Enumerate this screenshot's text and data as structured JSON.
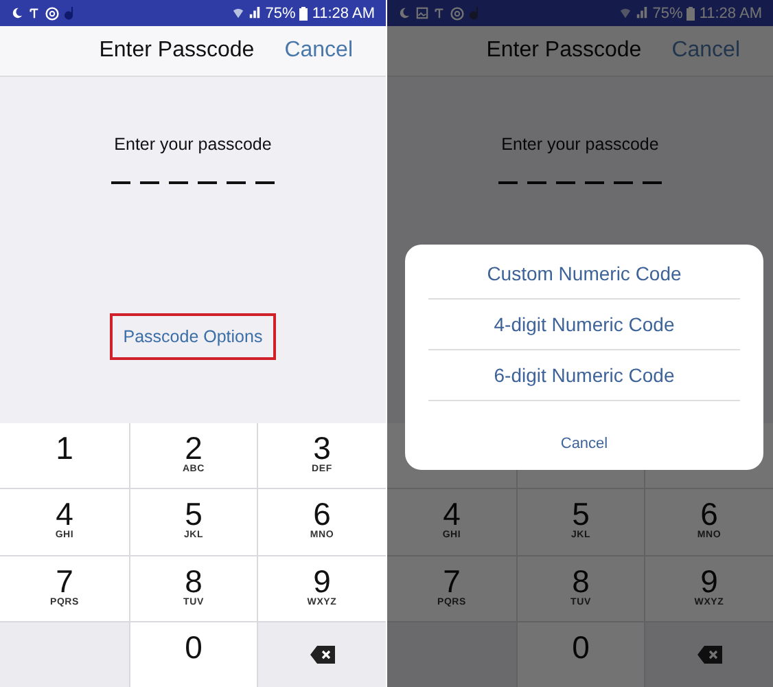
{
  "screens": [
    {
      "status_bar": {
        "battery": "75%",
        "time": "11:28 AM",
        "extra_icon": false
      },
      "title": "Enter Passcode",
      "cancel": "Cancel",
      "prompt": "Enter your passcode",
      "slots": [
        {
          "kind": "empty"
        },
        {
          "kind": "empty"
        },
        {
          "kind": "empty"
        },
        {
          "kind": "empty"
        },
        {
          "kind": "empty"
        },
        {
          "kind": "empty"
        }
      ],
      "options_link": {
        "label": "Passcode Options",
        "highlighted": true
      },
      "dimmed": false,
      "keypad": [
        {
          "kind": "digit",
          "digit": "1"
        },
        {
          "kind": "digit",
          "digit": "2",
          "letters": "ABC"
        },
        {
          "kind": "digit",
          "digit": "3",
          "letters": "DEF"
        },
        {
          "kind": "digit",
          "digit": "4",
          "letters": "GHI"
        },
        {
          "kind": "digit",
          "digit": "5",
          "letters": "JKL"
        },
        {
          "kind": "digit",
          "digit": "6",
          "letters": "MNO"
        },
        {
          "kind": "digit",
          "digit": "7",
          "letters": "PQRS"
        },
        {
          "kind": "digit",
          "digit": "8",
          "letters": "TUV"
        },
        {
          "kind": "digit",
          "digit": "9",
          "letters": "WXYZ"
        },
        {
          "kind": "blank"
        },
        {
          "kind": "digit",
          "digit": "0"
        },
        {
          "kind": "delete"
        }
      ]
    },
    {
      "status_bar": {
        "battery": "75%",
        "time": "11:28 AM",
        "extra_icon": true
      },
      "title": "Enter Passcode",
      "cancel": "Cancel",
      "prompt": "Enter your passcode",
      "slots": [
        {
          "kind": "empty"
        },
        {
          "kind": "empty"
        },
        {
          "kind": "empty"
        },
        {
          "kind": "empty"
        },
        {
          "kind": "empty"
        },
        {
          "kind": "empty"
        }
      ],
      "dimmed": true,
      "keypad": [
        {
          "kind": "hidden"
        },
        {
          "kind": "hidden"
        },
        {
          "kind": "hidden"
        },
        {
          "kind": "digit",
          "digit": "4",
          "letters": "GHI"
        },
        {
          "kind": "digit",
          "digit": "5",
          "letters": "JKL"
        },
        {
          "kind": "digit",
          "digit": "6",
          "letters": "MNO"
        },
        {
          "kind": "digit",
          "digit": "7",
          "letters": "PQRS"
        },
        {
          "kind": "digit",
          "digit": "8",
          "letters": "TUV"
        },
        {
          "kind": "digit",
          "digit": "9",
          "letters": "WXYZ"
        },
        {
          "kind": "blank"
        },
        {
          "kind": "digit",
          "digit": "0"
        },
        {
          "kind": "delete"
        }
      ],
      "sheet": {
        "options": [
          "Custom Numeric Code",
          "4-digit Numeric Code",
          "6-digit Numeric Code"
        ],
        "cancel": "Cancel"
      }
    }
  ]
}
